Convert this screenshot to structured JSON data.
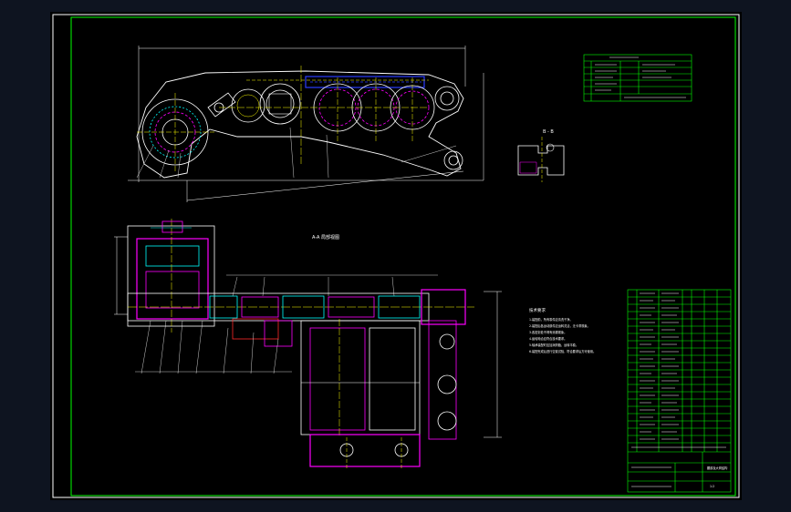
{
  "colors": {
    "viewport_bg": "#0e1420",
    "sheet_bg": "#000000",
    "frame": "#ffffff",
    "inner_frame": "#00ff00",
    "outline": "#ffffff",
    "section": "#ff00ff",
    "cyan": "#00ffff",
    "yellow": "#ffff00",
    "blue": "#2a3cff",
    "red": "#ff2a2a",
    "green": "#00ff00"
  },
  "drawing": {
    "section_a_label": "A-A 局部视图",
    "section_b_label": "B - B",
    "notes_title": "技术要求",
    "notes": [
      "1.装配前，所有零件应清洗干净。",
      "2.装配后各运动部件应运转灵活，无卡滞现象。",
      "3.各密封处不得有渗漏现象。",
      "4.齿轮啮合应符合技术要求。",
      "5.轴承装配时应加润滑脂，运转平稳。",
      "6.装配完成后进行空载试验，符合要求后方可使用。"
    ],
    "title_block": {
      "drawing_title": "腰部及大臂结构",
      "scale": "1:2"
    }
  }
}
